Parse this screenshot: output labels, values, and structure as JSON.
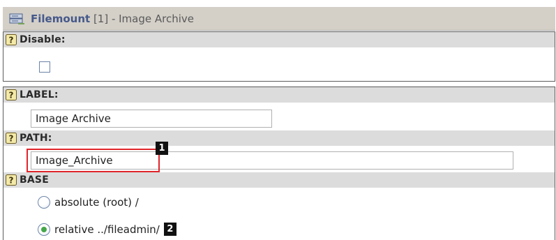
{
  "title": {
    "record_type": "Filemount",
    "rest": " [1] - Image Archive",
    "icon": "filemount-icon"
  },
  "fields": {
    "disable": {
      "label": "Disable:",
      "checked": false
    },
    "label": {
      "label": "LABEL:",
      "value": "Image Archive"
    },
    "path": {
      "label": "PATH:",
      "value": "Image_Archive"
    },
    "base": {
      "label": "BASE",
      "options": [
        {
          "label": "absolute (root) /",
          "checked": false
        },
        {
          "label": "relative ../fileadmin/",
          "checked": true
        }
      ]
    }
  },
  "annotations": {
    "marker_1": "1",
    "marker_2": "2",
    "highlight_color": "#e0262c"
  },
  "colors": {
    "field_header_bg": "#dcdcdc",
    "title_bar_bg": "#d4d0c8",
    "record_type": "#46598a",
    "radio_checked": "#46a64a"
  }
}
